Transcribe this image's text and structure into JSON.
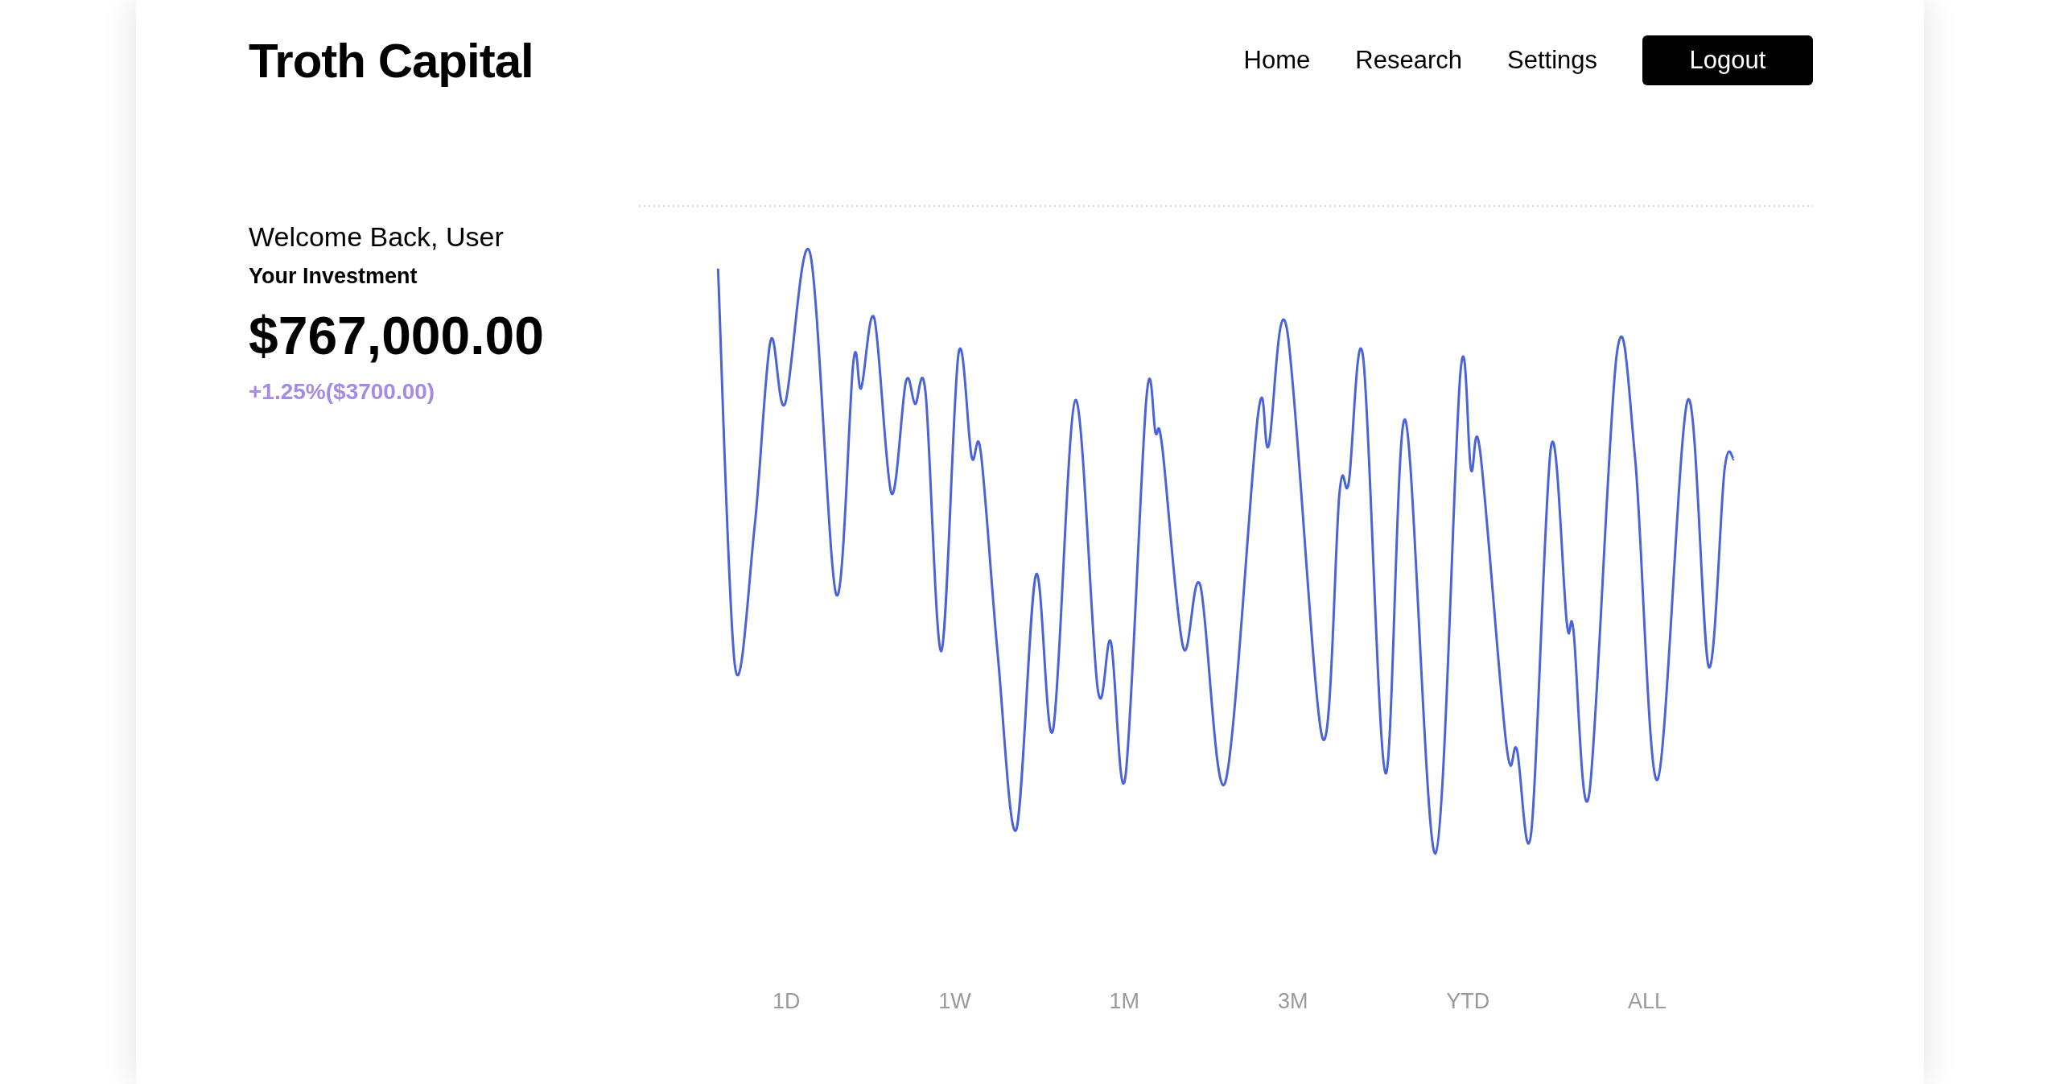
{
  "header": {
    "brand": "Troth Capital",
    "nav": [
      {
        "label": "Home"
      },
      {
        "label": "Research"
      },
      {
        "label": "Settings"
      }
    ],
    "logout_button": "Logout"
  },
  "summary": {
    "greeting": "Welcome Back, User",
    "subtitle": "Your Investment",
    "amount": "$767,000.00",
    "change": "+1.25%($3700.00)"
  },
  "ranges": [
    {
      "label": "1D"
    },
    {
      "label": "1W"
    },
    {
      "label": "1M"
    },
    {
      "label": "3M"
    },
    {
      "label": "YTD"
    },
    {
      "label": "ALL"
    }
  ]
}
